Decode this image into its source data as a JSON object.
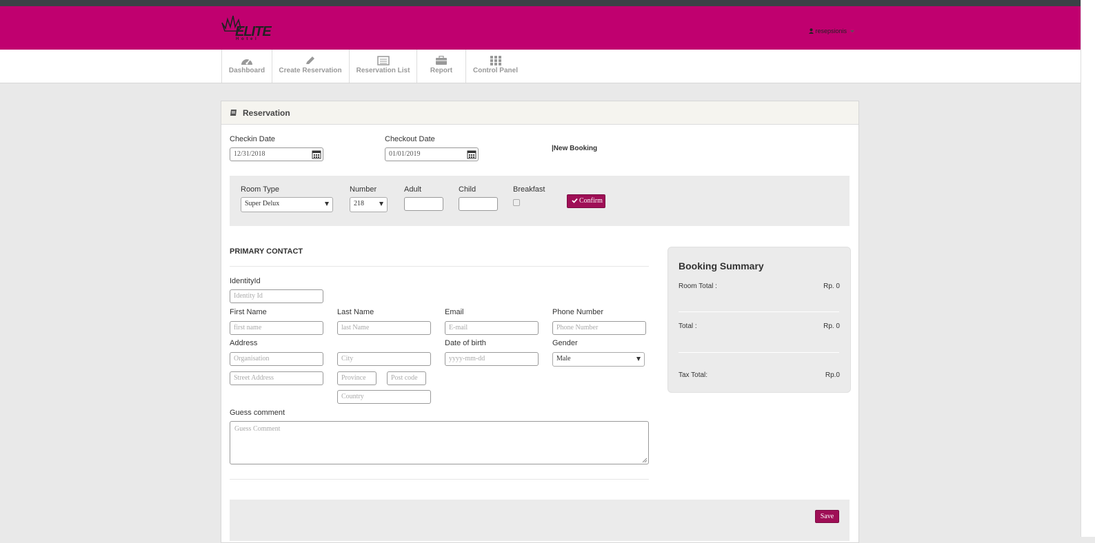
{
  "header": {
    "logo_text": "ELITE",
    "logo_subtext": "H o t e l",
    "user": "resepsionis",
    "colors": {
      "brand": "#c0006f",
      "button": "#9f0f56"
    }
  },
  "nav": [
    {
      "label": "Dashboard",
      "icon": "dashboard-icon"
    },
    {
      "label": "Create Reservation",
      "icon": "pencil-icon"
    },
    {
      "label": "Reservation List",
      "icon": "list-icon"
    },
    {
      "label": "Report",
      "icon": "briefcase-icon"
    },
    {
      "label": "Control Panel",
      "icon": "grid-icon"
    }
  ],
  "panel": {
    "title": "Reservation",
    "icon": "book-icon"
  },
  "dates": {
    "checkin_label": "Checkin Date",
    "checkin_value": "12/31/2018",
    "checkout_label": "Checkout Date",
    "checkout_value": "01/01/2019",
    "status": "|New Booking"
  },
  "room": {
    "room_type_label": "Room Type",
    "room_type_value": "Super Delux",
    "number_label": "Number",
    "number_value": "218",
    "adult_label": "Adult",
    "child_label": "Child",
    "breakfast_label": "Breakfast",
    "confirm_label": "Confirm"
  },
  "contact": {
    "section_title": "PRIMARY CONTACT",
    "identity_label": "IdentityId",
    "identity_placeholder": "Identity Id",
    "first_name_label": "First Name",
    "first_name_placeholder": "first name",
    "last_name_label": "Last Name",
    "last_name_placeholder": "last Name",
    "email_label": "Email",
    "email_placeholder": "E-mail",
    "phone_label": "Phone Number",
    "phone_placeholder": "Phone Number",
    "address_label": "Address",
    "organisation_placeholder": "Organisation",
    "city_placeholder": "City",
    "street_placeholder": "Street Address",
    "province_placeholder": "Province",
    "postcode_placeholder": "Post code",
    "country_placeholder": "Country",
    "dob_label": "Date of birth",
    "dob_placeholder": "yyyy-mm-dd",
    "gender_label": "Gender",
    "gender_value": "Male",
    "comment_label": "Guess comment",
    "comment_placeholder": "Guess Comment"
  },
  "summary": {
    "title": "Booking Summary",
    "room_total_label": "Room Total :",
    "room_total_value": "Rp. 0",
    "total_label": "Total :",
    "total_value": "Rp. 0",
    "tax_label": "Tax Total:",
    "tax_value": "Rp.0"
  },
  "footer": {
    "save_label": "Save"
  }
}
